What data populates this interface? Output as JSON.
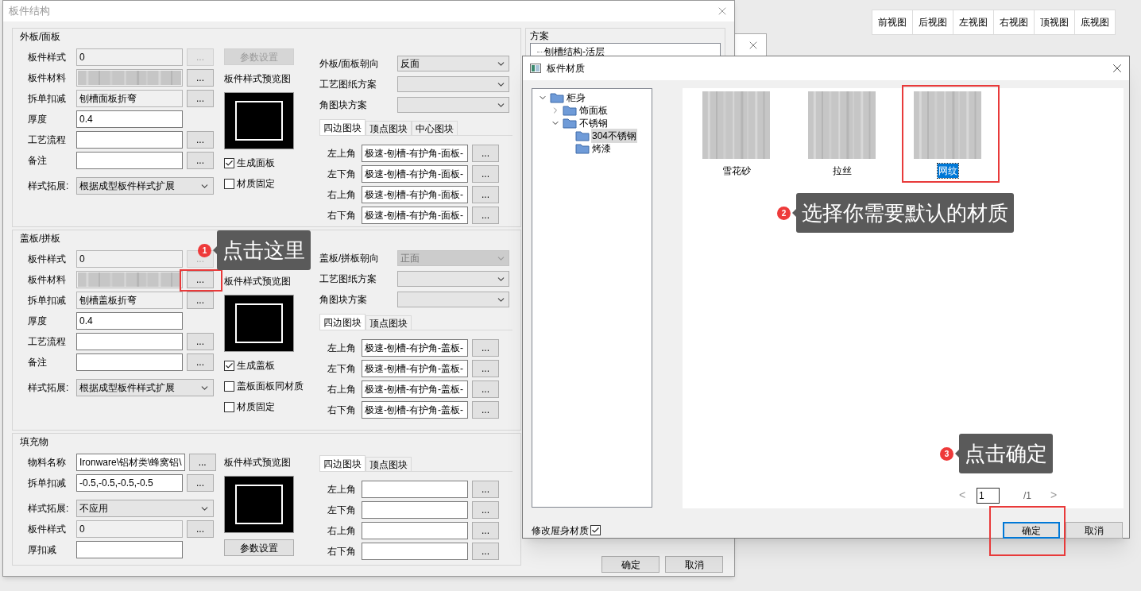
{
  "main_window": {
    "title": "板件结构",
    "sections": [
      {
        "title": "外板/面板",
        "rows": [
          {
            "label": "板件样式",
            "kind": "readonly",
            "value": "0",
            "button": "...",
            "button_disabled": true
          },
          {
            "label": "板件材料",
            "kind": "texture",
            "button": "...",
            "button_disabled": false
          },
          {
            "label": "拆单扣减",
            "kind": "readonly",
            "value": "刨槽面板折弯",
            "button": "...",
            "button_disabled": false
          },
          {
            "label": "厚度",
            "kind": "text",
            "value": "0.4"
          },
          {
            "label": "工艺流程",
            "kind": "text",
            "button": "...",
            "button_disabled": false
          },
          {
            "label": "备注",
            "kind": "text",
            "button": "...",
            "button_disabled": false
          },
          {
            "label": "样式拓展:",
            "kind": "select",
            "value": "根据成型板件样式扩展"
          }
        ],
        "middle": [
          {
            "kind": "button",
            "label": "参数设置",
            "disabled": true
          },
          {
            "kind": "caption",
            "label": "板件样式预览图"
          },
          {
            "kind": "preview"
          },
          {
            "kind": "checkbox",
            "label": "生成面板",
            "checked": true
          },
          {
            "kind": "checkbox",
            "label": "材质固定",
            "checked": false
          }
        ],
        "options": [
          {
            "label": "外板/面板朝向",
            "value": "反面",
            "disabled": false
          },
          {
            "label": "工艺图纸方案",
            "disabled": false
          },
          {
            "label": "角图块方案",
            "disabled": false
          }
        ],
        "tabs": [
          {
            "label": "四边图块",
            "selected": true
          },
          {
            "label": "顶点图块",
            "selected": false
          },
          {
            "label": "中心图块",
            "selected": false
          }
        ],
        "corners": [
          {
            "label": "左上角",
            "value": "极速-刨槽-有护角-面板-",
            "button": "..."
          },
          {
            "label": "左下角",
            "value": "极速-刨槽-有护角-面板-",
            "button": "..."
          },
          {
            "label": "右上角",
            "value": "极速-刨槽-有护角-面板-",
            "button": "..."
          },
          {
            "label": "右下角",
            "value": "极速-刨槽-有护角-面板-",
            "button": "..."
          }
        ]
      },
      {
        "title": "盖板/拼板",
        "rows": [
          {
            "label": "板件样式",
            "kind": "readonly",
            "value": "0",
            "button": "...",
            "button_disabled": true
          },
          {
            "label": "板件材料",
            "kind": "texture",
            "button": "...",
            "button_disabled": false
          },
          {
            "label": "拆单扣减",
            "kind": "readonly",
            "value": "刨槽盖板折弯",
            "button": "...",
            "button_disabled": false
          },
          {
            "label": "厚度",
            "kind": "text",
            "value": "0.4"
          },
          {
            "label": "工艺流程",
            "kind": "text",
            "button": "...",
            "button_disabled": false
          },
          {
            "label": "备注",
            "kind": "text",
            "button": "...",
            "button_disabled": false
          },
          {
            "label": "样式拓展:",
            "kind": "select",
            "value": "根据成型板件样式扩展"
          }
        ],
        "middle": [
          {
            "kind": "caption",
            "label": "板件样式预览图"
          },
          {
            "kind": "preview"
          },
          {
            "kind": "checkbox",
            "label": "生成盖板",
            "checked": true
          },
          {
            "kind": "checkbox",
            "label": "盖板面板同材质",
            "checked": false
          },
          {
            "kind": "checkbox",
            "label": "材质固定",
            "checked": false
          }
        ],
        "options": [
          {
            "label": "盖板/拼板朝向",
            "value": "正面",
            "disabled": true
          },
          {
            "label": "工艺图纸方案",
            "disabled": false
          },
          {
            "label": "角图块方案",
            "disabled": false
          }
        ],
        "tabs": [
          {
            "label": "四边图块",
            "selected": true
          },
          {
            "label": "顶点图块",
            "selected": false
          }
        ],
        "corners": [
          {
            "label": "左上角",
            "value": "极速-刨槽-有护角-盖板-",
            "button": "..."
          },
          {
            "label": "左下角",
            "value": "极速-刨槽-有护角-盖板-",
            "button": "..."
          },
          {
            "label": "右上角",
            "value": "极速-刨槽-有护角-盖板-",
            "button": "..."
          },
          {
            "label": "右下角",
            "value": "极速-刨槽-有护角-盖板-",
            "button": "..."
          }
        ]
      },
      {
        "title": "填充物",
        "rows": [
          {
            "label": "物料名称",
            "kind": "text",
            "value": "Ironware\\铝材类\\蜂窝铝\\",
            "button": "...",
            "button_disabled": false
          },
          {
            "label": "拆单扣减",
            "kind": "text",
            "value": "-0.5,-0.5,-0.5,-0.5",
            "button": "...",
            "button_disabled": false
          },
          {
            "label": "样式拓展:",
            "kind": "select",
            "value": "不应用"
          },
          {
            "label": "板件样式",
            "kind": "readonly",
            "value": "0",
            "button": "...",
            "button_disabled": false
          },
          {
            "label": "厚扣减",
            "kind": "text"
          }
        ],
        "middle": [
          {
            "kind": "caption",
            "label": "板件样式预览图"
          },
          {
            "kind": "preview"
          },
          {
            "kind": "button",
            "label": "参数设置",
            "disabled": false
          }
        ],
        "tabs": [
          {
            "label": "四边图块",
            "selected": true
          },
          {
            "label": "顶点图块",
            "selected": false
          }
        ],
        "corners": [
          {
            "label": "左上角",
            "button": "..."
          },
          {
            "label": "左下角",
            "button": "..."
          },
          {
            "label": "右上角",
            "button": "..."
          },
          {
            "label": "右下角",
            "button": "..."
          }
        ]
      }
    ],
    "scheme": {
      "title": "方案",
      "items": [
        {
          "label": "刨槽结构-活层",
          "selected": false
        }
      ]
    },
    "buttons": [
      "确定",
      "取消"
    ]
  },
  "material_window": {
    "title": "板件材质",
    "tree": [
      {
        "label": "柜身",
        "expanded": true,
        "selected": false,
        "children": [
          {
            "label": "饰面板",
            "expanded": false,
            "selected": false
          },
          {
            "label": "不锈钢",
            "expanded": true,
            "selected": false,
            "children": [
              {
                "label": "304不锈钢",
                "selected": true
              },
              {
                "label": "烤漆",
                "selected": false
              }
            ]
          }
        ]
      }
    ],
    "materials": [
      {
        "label": "雪花砂",
        "selected": false
      },
      {
        "label": "拉丝",
        "selected": false
      },
      {
        "label": "网纹",
        "selected": true
      }
    ],
    "pager": {
      "prev": "<",
      "page": "1",
      "total": "/1",
      "next": ">"
    },
    "option": {
      "label": "修改屉身材质",
      "checked": true
    },
    "buttons": [
      {
        "label": "确定",
        "default": true
      },
      {
        "label": "取消",
        "default": false
      }
    ]
  },
  "toolbar": {
    "buttons": [
      "前视图",
      "后视图",
      "左视图",
      "右视图",
      "顶视图",
      "底视图"
    ]
  },
  "callouts": [
    {
      "number": "1",
      "text": "点击这里"
    },
    {
      "number": "2",
      "text": "选择你需要默认的材质"
    },
    {
      "number": "3",
      "text": "点击确定"
    }
  ]
}
